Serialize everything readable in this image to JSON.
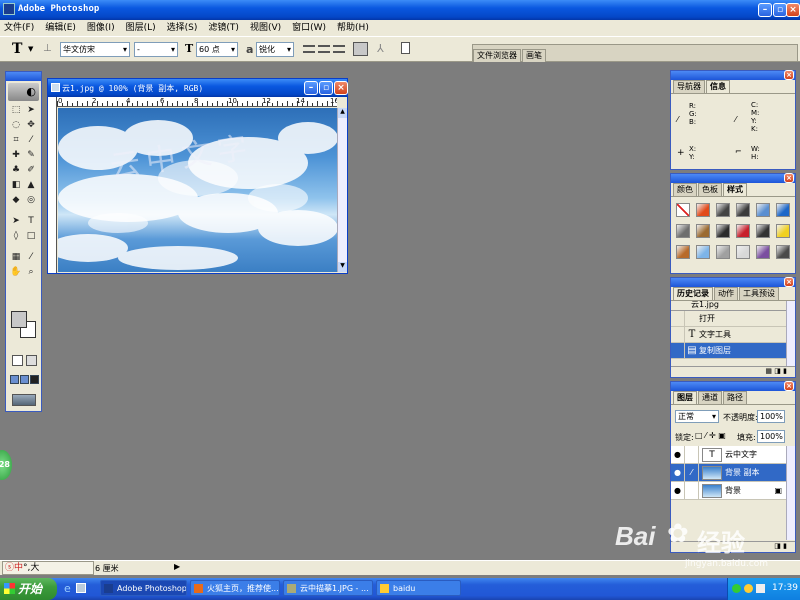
{
  "app": {
    "title": "Adobe Photoshop"
  },
  "menu": [
    "文件(F)",
    "编辑(E)",
    "图像(I)",
    "图层(L)",
    "选择(S)",
    "滤镜(T)",
    "视图(V)",
    "窗口(W)",
    "帮助(H)"
  ],
  "options": {
    "tool_glyph": "T",
    "font_family": "华文仿宋",
    "font_style": "-",
    "font_size": "60 点",
    "aa_label": "a",
    "antialias": "锐化",
    "palette_tabs": [
      "文件浏览器",
      "画笔"
    ]
  },
  "document": {
    "title": "云1.jpg @ 100% (背景 副本, RGB)",
    "ruler_numbers": [
      "0",
      "2",
      "4",
      "6",
      "8",
      "10",
      "12",
      "14",
      "16"
    ],
    "overlay_text": "云中文字"
  },
  "navigator": {
    "tabs": [
      "导航器",
      "信息"
    ],
    "rgb_labels": "R:\nG:\nB:",
    "cmyk_labels": "C:\nM:\nY:\nK:",
    "xy_labels": "X:\nY:",
    "wh_labels": "W:\nH:"
  },
  "swatches": {
    "tabs": [
      "颜色",
      "色板",
      "样式"
    ],
    "styles": [
      "#c0c0c0",
      "#e24a1a",
      "#444444",
      "#3b3b3b",
      "#5a8fd1",
      "#1d67c8",
      "#6e6e6e",
      "#9b6a30",
      "#2b2b2b",
      "#c8202c",
      "#333333",
      "#f0d020",
      "#b86a2a",
      "#7db4e8",
      "#a0a0a0",
      "#d8d8d8",
      "#7b4ea0",
      "#4a4a4a"
    ]
  },
  "history": {
    "tabs": [
      "历史记录",
      "动作",
      "工具预设"
    ],
    "snapshot": "云1.jpg",
    "items": [
      {
        "icon": "",
        "label": "打开"
      },
      {
        "icon": "T",
        "label": "文字工具"
      },
      {
        "icon": "▤",
        "label": "复制图层"
      }
    ]
  },
  "layers": {
    "tabs": [
      "图层",
      "通道",
      "路径"
    ],
    "blend_mode": "正常",
    "opacity_label": "不透明度:",
    "opacity_value": "100%",
    "lock_label": "锁定:",
    "fill_label": "填充:",
    "fill_value": "100%",
    "items": [
      {
        "thumb": "T",
        "name": "云中文字"
      },
      {
        "thumb": "",
        "name": "背景 副本"
      },
      {
        "thumb": "",
        "name": "背景"
      }
    ]
  },
  "statusbar": {
    "unit": "6 厘米",
    "ime": "中",
    "ime_extra": "°,大"
  },
  "badge": "28",
  "watermark": {
    "brand": "Bai",
    "brand2": "经验",
    "url": "jingyan.baidu.com"
  },
  "taskbar": {
    "start": "开始",
    "tasks": [
      "Adobe Photoshop",
      "火狐主页，推荐使...",
      "云中描摹1.JPG - ...",
      "baidu"
    ],
    "clock": "17:39"
  },
  "colors": {
    "fg": "#c8c8c8",
    "bg": "#ffffff"
  }
}
